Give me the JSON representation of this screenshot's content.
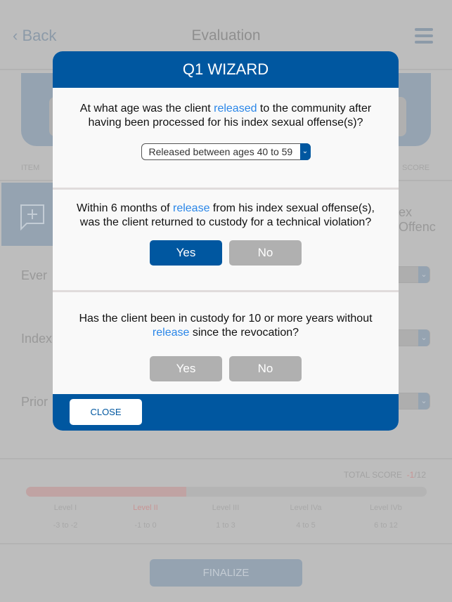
{
  "header": {
    "back_label": "Back",
    "title": "Evaluation"
  },
  "table": {
    "col_item": "ITEM",
    "col_score": "SCORE",
    "row1_text": "ex Offenc",
    "rows": [
      "Ever",
      "Index",
      "Prior"
    ]
  },
  "score": {
    "label": "TOTAL SCORE",
    "value": "-1",
    "max": "/12",
    "progress_percent": 40,
    "levels": [
      {
        "name": "Level I",
        "range": "-3 to -2"
      },
      {
        "name": "Level II",
        "range": "-1 to 0",
        "active": true
      },
      {
        "name": "Level III",
        "range": "1 to 3"
      },
      {
        "name": "Level IVa",
        "range": "4 to 5"
      },
      {
        "name": "Level IVb",
        "range": "6 to 12"
      }
    ]
  },
  "finalize_label": "FINALIZE",
  "modal": {
    "title": "Q1 WIZARD",
    "q1": {
      "pre": "At what age was the client ",
      "hl": "released",
      "post": " to the community after having been processed for his index sexual offense(s)?",
      "selected": "Released between ages 40 to 59"
    },
    "q2": {
      "pre": "Within 6 months of ",
      "hl": "release",
      "post": " from his index sexual offense(s), was the client returned to custody for a technical violation?",
      "yes": "Yes",
      "no": "No",
      "answer": "Yes"
    },
    "q3": {
      "pre": "Has the client been in custody for 10 or more years without ",
      "hl": "release",
      "post": " since the revocation?",
      "yes": "Yes",
      "no": "No",
      "answer": null
    },
    "close_label": "CLOSE"
  },
  "colors": {
    "primary": "#0057a0",
    "highlight": "#2a86e8",
    "active_level": "#d09090"
  }
}
